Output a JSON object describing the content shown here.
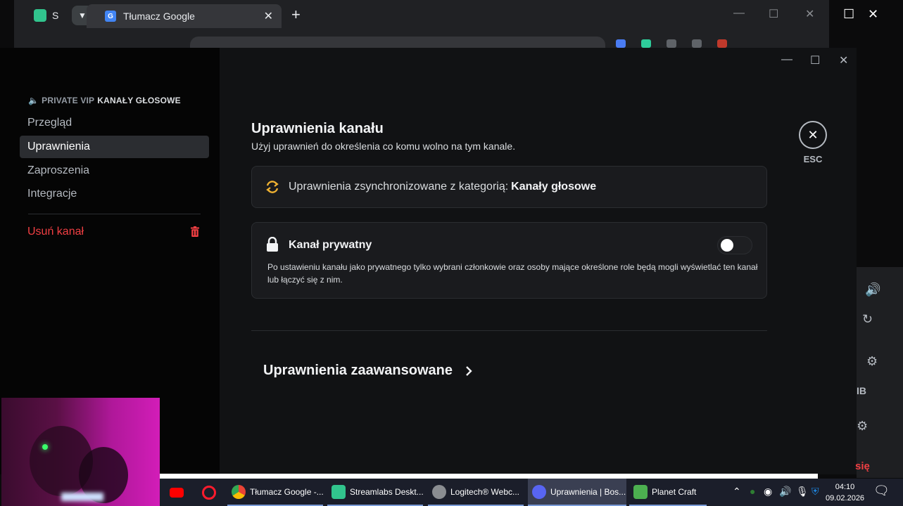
{
  "browser": {
    "left_tab_label": "S",
    "active_tab_title": "Tłumacz Google",
    "tab_close": "✕",
    "new_tab": "+",
    "window_min": "—",
    "window_max": "☐",
    "window_close": "✕"
  },
  "settings": {
    "channel_category": "PRIVATE VIP",
    "channel_name": "KANAŁY GŁOSOWE",
    "nav": [
      {
        "label": "Przegląd"
      },
      {
        "label": "Uprawnienia"
      },
      {
        "label": "Zaproszenia"
      },
      {
        "label": "Integracje"
      }
    ],
    "delete_label": "Usuń kanał",
    "title": "Uprawnienia kanału",
    "subtitle": "Użyj uprawnień do określenia co komu wolno na tym kanale.",
    "sync_text": "Uprawnienia zsynchronizowane z kategorią:",
    "sync_category": "Kanały głosowe",
    "private_title": "Kanał prywatny",
    "private_desc": "Po ustawieniu kanału jako prywatnego tylko wybrani członkowie oraz osoby mające określone role będą mogli wyświetlać ten kanał lub łączyć się z nim.",
    "private_enabled": false,
    "advanced_label": "Uprawnienia zaawansowane",
    "esc_label": "ESC"
  },
  "background": {
    "right_text_ib": "IB",
    "right_text_sie": "się"
  },
  "taskbar": {
    "apps": [
      {
        "label": "Tłumacz Google -..."
      },
      {
        "label": "Streamlabs Deskt..."
      },
      {
        "label": "Logitech® Webc..."
      },
      {
        "label": "Uprawnienia | Bos..."
      },
      {
        "label": "Planet Craft"
      }
    ],
    "time": "04:10",
    "date": "09.02.2026"
  },
  "colors": {
    "accent_red": "#f23f43",
    "sync_icon": "#f0b232",
    "active_item_bg": "#2b2d31"
  }
}
